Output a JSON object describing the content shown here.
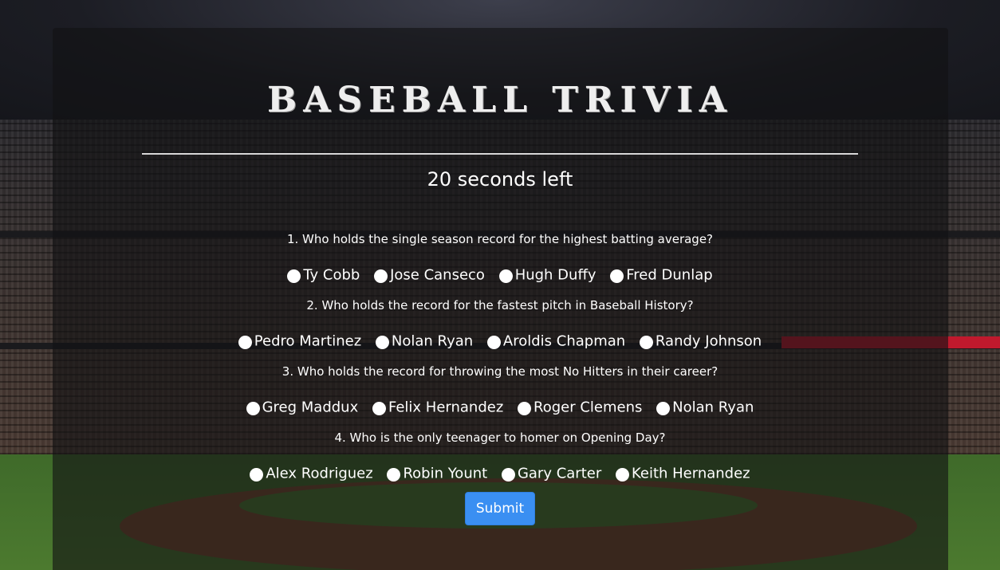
{
  "page": {
    "title": "BASEBALL TRIVIA",
    "timer_text": "20 seconds left"
  },
  "questions": [
    {
      "text": "1. Who holds the single season record for the highest batting average?",
      "options": [
        "Ty Cobb",
        "Jose Canseco",
        "Hugh Duffy",
        "Fred Dunlap"
      ]
    },
    {
      "text": "2. Who holds the record for the fastest pitch in Baseball History?",
      "options": [
        "Pedro Martinez",
        "Nolan Ryan",
        "Aroldis Chapman",
        "Randy Johnson"
      ]
    },
    {
      "text": "3. Who holds the record for throwing the most No Hitters in their career?",
      "options": [
        "Greg Maddux",
        "Felix Hernandez",
        "Roger Clemens",
        "Nolan Ryan"
      ]
    },
    {
      "text": "4. Who is the only teenager to homer on Opening Day?",
      "options": [
        "Alex Rodriguez",
        "Robin Yount",
        "Gary Carter",
        "Keith Hernandez"
      ]
    }
  ],
  "submit_label": "Submit",
  "colors": {
    "accent": "#3a8ff2",
    "panel": "#121214",
    "text": "#ffffff"
  }
}
